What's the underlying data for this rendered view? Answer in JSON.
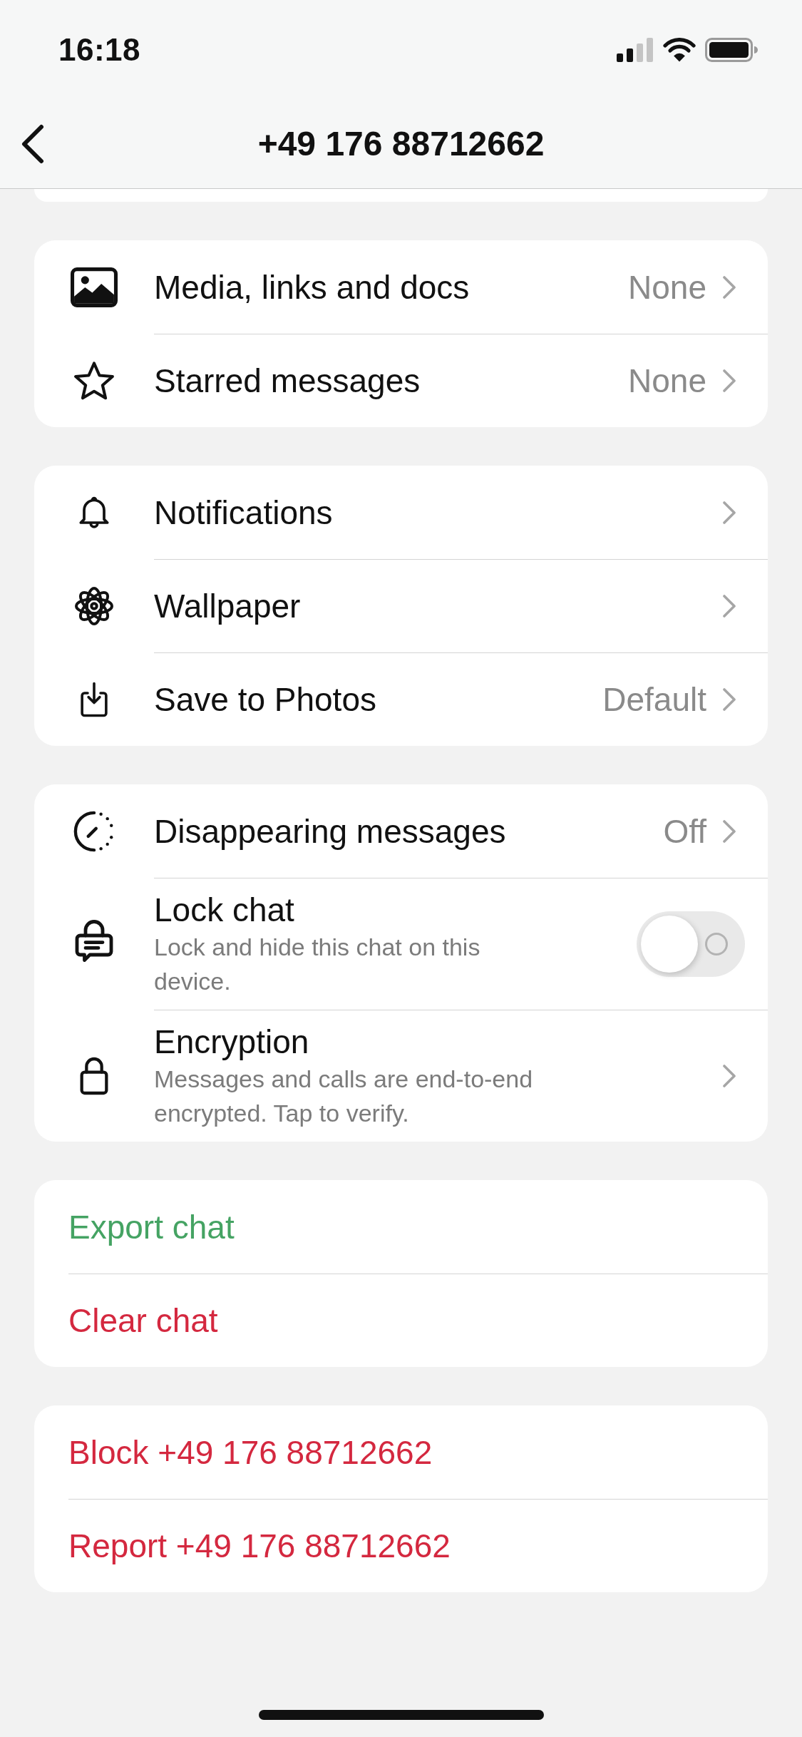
{
  "status_bar": {
    "time": "16:18"
  },
  "nav": {
    "title": "+49 176 88712662"
  },
  "sections": [
    {
      "rows": [
        {
          "kind": "link",
          "label": "Media, links and docs",
          "value": "None"
        },
        {
          "kind": "link",
          "label": "Starred messages",
          "value": "None"
        }
      ]
    },
    {
      "rows": [
        {
          "kind": "link",
          "label": "Notifications"
        },
        {
          "kind": "link",
          "label": "Wallpaper"
        },
        {
          "kind": "link",
          "label": "Save to Photos",
          "value": "Default"
        }
      ]
    },
    {
      "rows": [
        {
          "kind": "link",
          "label": "Disappearing messages",
          "value": "Off"
        },
        {
          "kind": "toggle",
          "label": "Lock chat",
          "subtitle": "Lock and hide this chat on this device.",
          "on": false
        },
        {
          "kind": "link",
          "label": "Encryption",
          "subtitle": "Messages and calls are end-to-end encrypted. Tap to verify."
        }
      ]
    },
    {
      "rows": [
        {
          "kind": "action",
          "label": "Export chat",
          "color": "#45a363"
        },
        {
          "kind": "action",
          "label": "Clear chat",
          "color": "#d4283f"
        }
      ]
    },
    {
      "rows": [
        {
          "kind": "action",
          "label": "Block +49 176 88712662",
          "color": "#d4283f"
        },
        {
          "kind": "action",
          "label": "Report +49 176 88712662",
          "color": "#d4283f"
        }
      ]
    }
  ]
}
